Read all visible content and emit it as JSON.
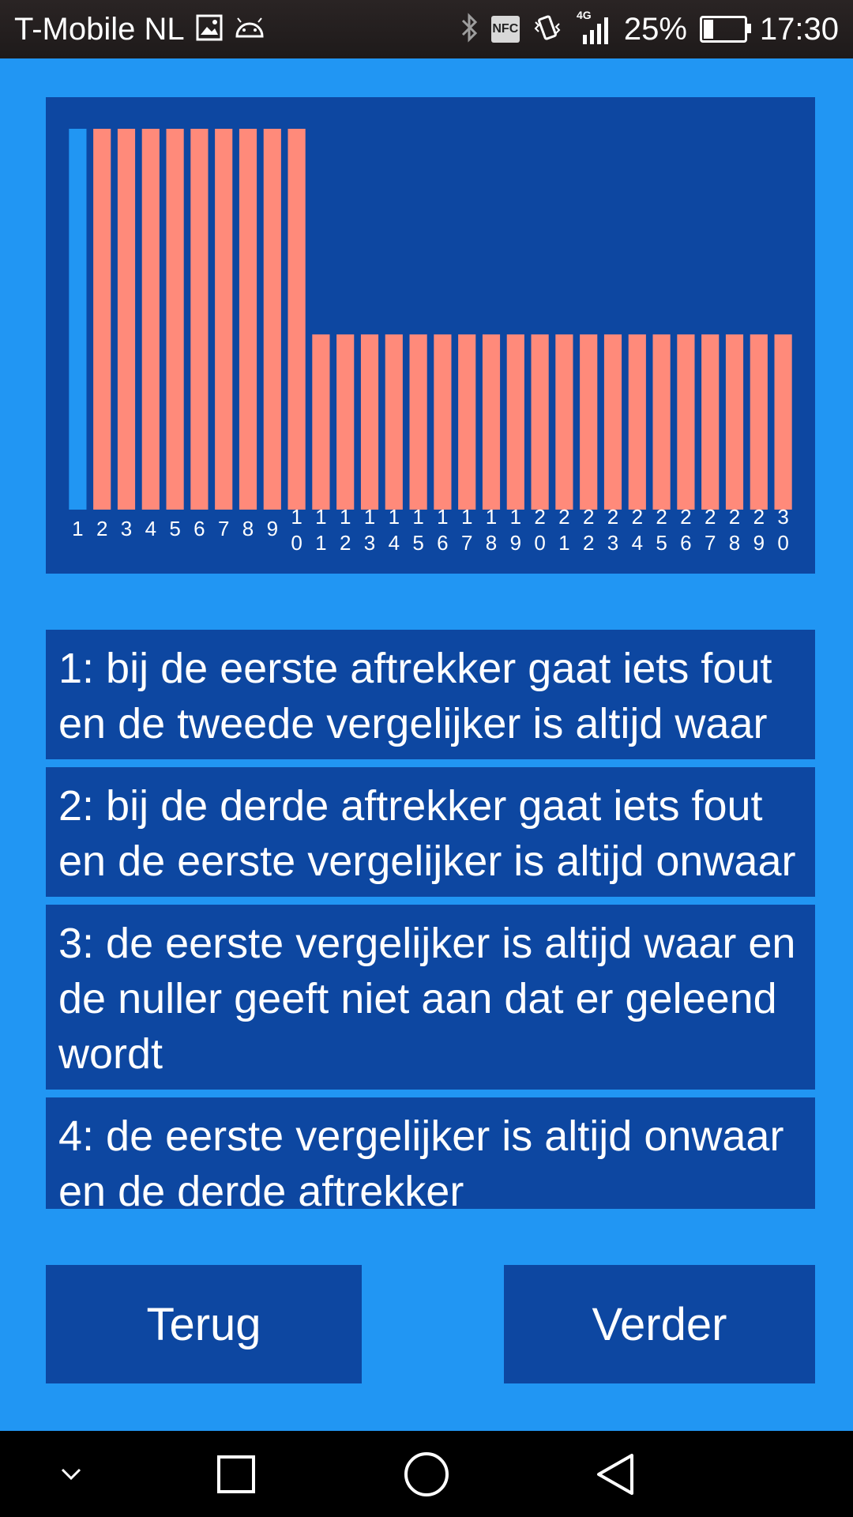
{
  "status_bar": {
    "carrier": "T-Mobile NL",
    "network": "4G",
    "battery": "25%",
    "time": "17:30",
    "icons": [
      "image-icon",
      "android-icon",
      "bluetooth-icon",
      "nfc-icon",
      "vibrate-icon",
      "signal-icon",
      "battery-icon"
    ]
  },
  "chart_data": {
    "type": "bar",
    "categories": [
      "1",
      "2",
      "3",
      "4",
      "5",
      "6",
      "7",
      "8",
      "9",
      "10",
      "11",
      "12",
      "13",
      "14",
      "15",
      "16",
      "17",
      "18",
      "19",
      "20",
      "21",
      "22",
      "23",
      "24",
      "25",
      "26",
      "27",
      "28",
      "29",
      "30"
    ],
    "values": [
      100,
      100,
      100,
      100,
      100,
      100,
      100,
      100,
      100,
      100,
      46,
      46,
      46,
      46,
      46,
      46,
      46,
      46,
      46,
      46,
      46,
      46,
      46,
      46,
      46,
      46,
      46,
      46,
      46,
      46
    ],
    "highlighted_index": 0,
    "colors": {
      "highlight": "#2196F3",
      "bar": "#FF8A7A",
      "background": "#0D47A1",
      "label": "#FFFFFF"
    },
    "ylim": [
      0,
      100
    ],
    "grid": false,
    "title": "",
    "xlabel": "",
    "ylabel": ""
  },
  "list": {
    "items": [
      "1: bij de eerste aftrekker gaat iets fout en de tweede vergelijker is altijd waar",
      "2: bij de derde aftrekker gaat iets fout en de eerste vergelijker is altijd onwaar",
      "3: de eerste vergelijker is altijd waar en de nuller geeft niet aan dat er geleend wordt",
      "4: de eerste vergelijker is altijd onwaar en de derde aftrekker"
    ]
  },
  "buttons": {
    "back_label": "Terug",
    "next_label": "Verder"
  },
  "nav_bar": {
    "icons": [
      "chevron-down-icon",
      "recent-apps-icon",
      "home-icon",
      "back-icon"
    ]
  }
}
